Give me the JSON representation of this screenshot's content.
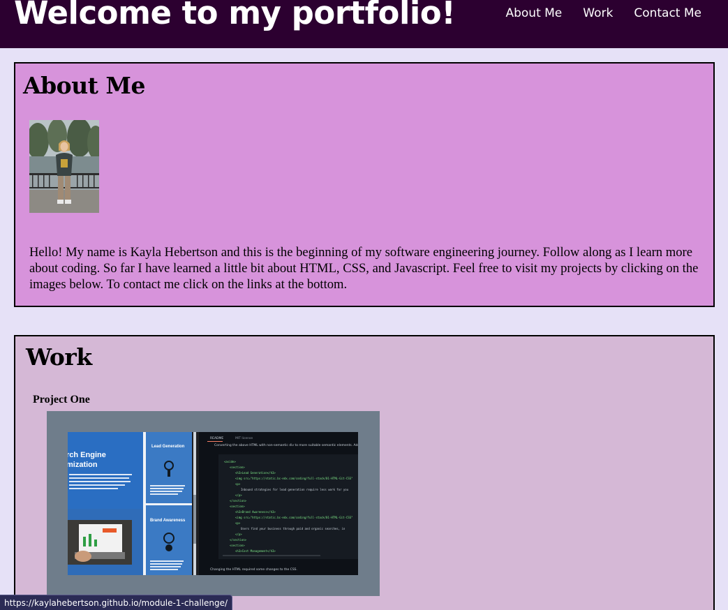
{
  "header": {
    "title": "Welcome to my portfolio!",
    "nav": [
      "About Me",
      "Work",
      "Contact Me"
    ]
  },
  "about": {
    "heading": "About Me",
    "text": "Hello! My name is Kayla Hebertson and this is the beginning of my software engineering journey. Follow along as I learn more about coding. So far I have learned a little bit about HTML, CSS, and Javascript. Feel free to visit my projects by clicking on the images below. To contact me click on the links at the bottom."
  },
  "work": {
    "heading": "Work",
    "project_one": {
      "title": "Project One",
      "screenshot": {
        "card_title": "rch Engine\nmization",
        "lead_generation": "Lead Generation",
        "brand_awareness": "Brand Awareness",
        "readme_tab": "README",
        "license_tab": "MIT license",
        "readme_intro": "Converting the above HTML with non-semantic div to more suitable semantic elements. Adding attributes to make HTML more accessible.",
        "readme_footer": "Changing the HTML required some changes to the CSS."
      }
    }
  },
  "status_bar": {
    "url": "https://kaylahebertson.github.io/module-1-challenge/"
  },
  "colors": {
    "header_bg": "#2c0030",
    "page_bg": "#e6e1f7",
    "about_bg": "#d793db",
    "work_bg": "#d5b8d6",
    "frame": "#6f7d8b"
  }
}
